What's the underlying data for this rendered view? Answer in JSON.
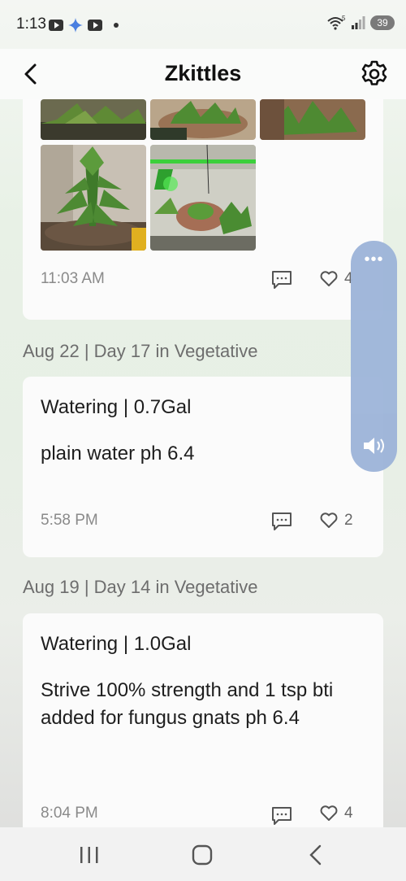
{
  "status_bar": {
    "time": "1:13",
    "battery": "39",
    "wifi_label": "5"
  },
  "header": {
    "title": "Zkittles"
  },
  "entries": [
    {
      "time": "11:03 AM",
      "likes": "4"
    },
    {
      "date": "Aug 22 | Day 17 in Vegetative",
      "title": "Watering | 0.7Gal",
      "text": "plain water ph 6.4",
      "time": "5:58 PM",
      "likes": "2"
    },
    {
      "date": "Aug 19 | Day 14 in Vegetative",
      "title": "Watering | 1.0Gal",
      "text": "Strive 100% strength and 1 tsp bti added for fungus gnats ph 6.4",
      "time": "8:04 PM",
      "likes": "4"
    }
  ],
  "side_panel": {
    "more": "•••"
  },
  "icons": [
    "back-arrow-icon",
    "gear-icon",
    "comment-icon",
    "heart-icon",
    "volume-icon",
    "recent-apps-icon",
    "home-icon",
    "nav-back-icon"
  ]
}
